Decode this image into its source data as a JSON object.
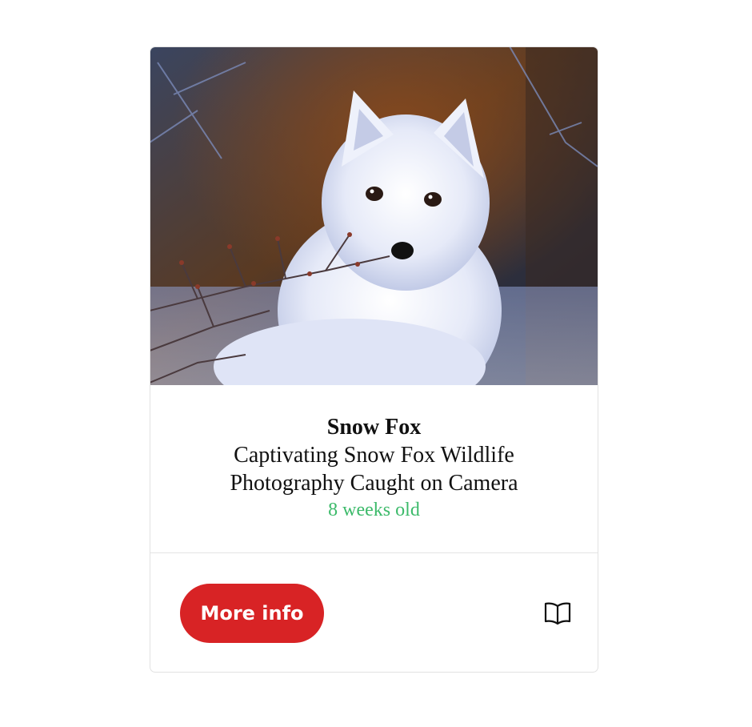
{
  "card": {
    "image_alt": "Arctic snow fox in the wild",
    "title": "Snow Fox",
    "subtitle": "Captivating Snow Fox Wildlife Photography Caught on Camera",
    "age": "8 weeks old",
    "more_info_label": "More info",
    "book_icon": "open-book-icon"
  },
  "colors": {
    "accent": "#d82325",
    "age_text": "#3cba6a",
    "border": "#e2e2e2"
  }
}
